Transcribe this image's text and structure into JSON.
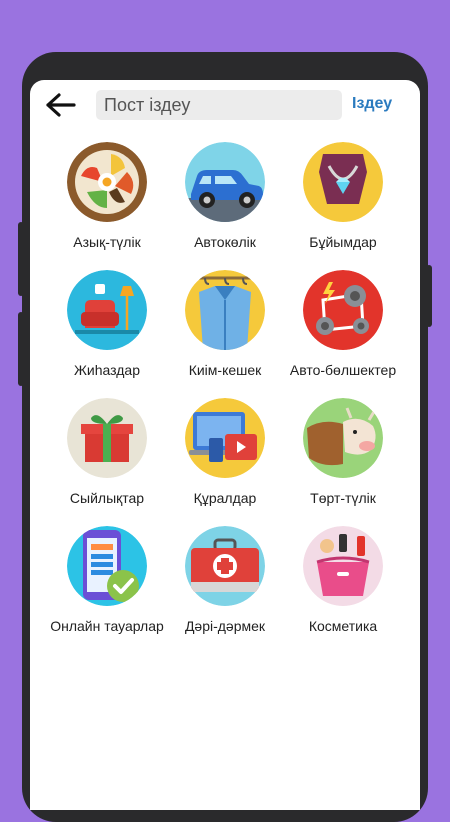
{
  "header": {
    "search_placeholder": "Пост іздеу",
    "search_button": "Іздеу"
  },
  "categories": [
    {
      "label": "Азық-түлік",
      "icon": "food-bowl-icon"
    },
    {
      "label": "Автокөлік",
      "icon": "car-icon"
    },
    {
      "label": "Бұйымдар",
      "icon": "necklace-icon"
    },
    {
      "label": "Жиһаздар",
      "icon": "armchair-lamp-icon"
    },
    {
      "label": "Киім-кешек",
      "icon": "clothes-rack-icon"
    },
    {
      "label": "Авто-бөлшектер",
      "icon": "engine-belt-icon"
    },
    {
      "label": "Сыйлықтар",
      "icon": "gift-box-icon"
    },
    {
      "label": "Құралдар",
      "icon": "devices-icon"
    },
    {
      "label": "Төрт-түлік",
      "icon": "cow-icon"
    },
    {
      "label": "Онлайн тауарлар",
      "icon": "online-shop-phone-icon"
    },
    {
      "label": "Дәрі-дәрмек",
      "icon": "first-aid-kit-icon"
    },
    {
      "label": "Косметика",
      "icon": "cosmetics-bag-icon"
    }
  ]
}
